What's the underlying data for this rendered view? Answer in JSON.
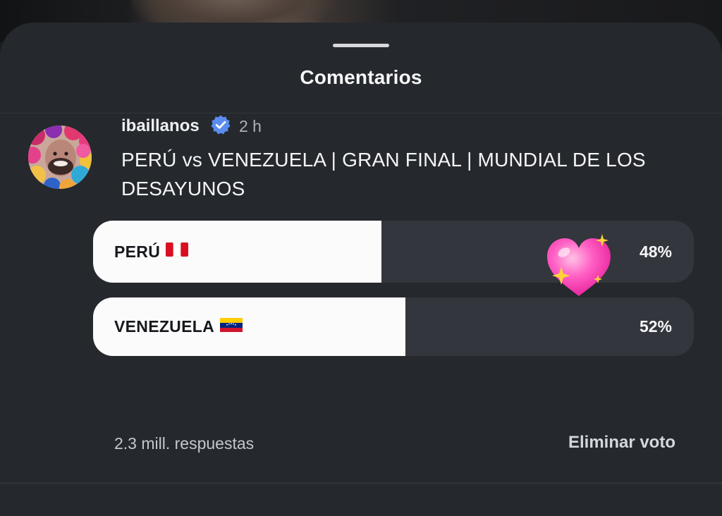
{
  "sheet": {
    "title": "Comentarios"
  },
  "comment": {
    "username": "ibaillanos",
    "timestamp": "2 h",
    "text": "PERÚ vs VENEZUELA | GRAN FINAL | MUNDIAL DE LOS DESAYUNOS"
  },
  "poll": {
    "options": [
      {
        "label": "PERÚ",
        "flag": "peru-flag-icon",
        "percent_label": "48%",
        "share": 0.48
      },
      {
        "label": "VENEZUELA",
        "flag": "venezuela-flag-icon",
        "percent_label": "52%",
        "share": 0.52
      }
    ],
    "reaction": "sparkling-heart-icon",
    "responses": "2.3 mill. respuestas",
    "remove_vote": "Eliminar voto"
  },
  "colors": {
    "sheet_bg": "#25282d",
    "fill": "#fbfbfc",
    "track": "#33363c",
    "verified": "#5b8cf0"
  }
}
